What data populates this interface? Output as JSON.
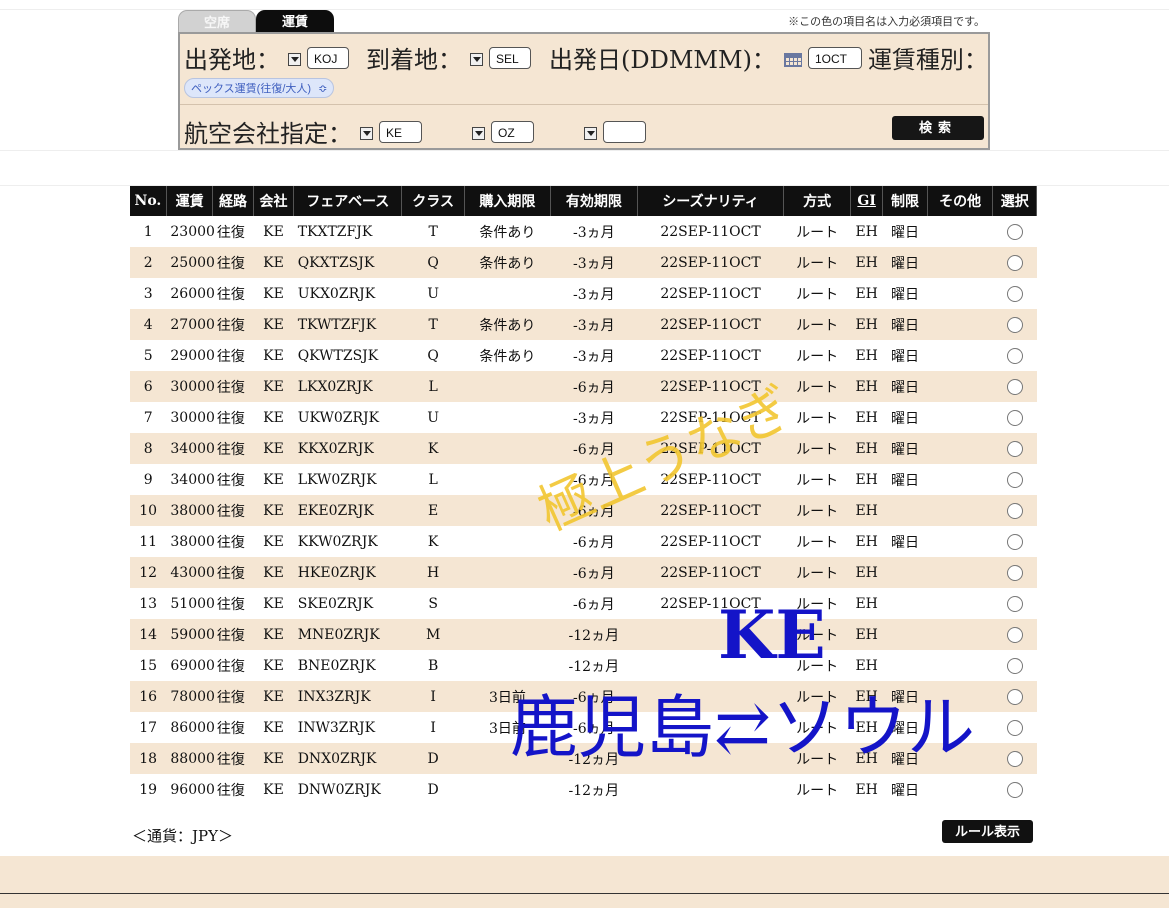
{
  "tabs": [
    {
      "label": "空席",
      "active": false
    },
    {
      "label": "運賃",
      "active": true
    }
  ],
  "required_note": "※この色の項目名は入力必須項目です。",
  "search": {
    "origin_label": "出発地：",
    "origin_value": "KOJ",
    "dest_label": "到着地：",
    "dest_value": "SEL",
    "date_label": "出発日(DDMMM)：",
    "date_value": "1OCT",
    "fare_type_label": "運賃種別：",
    "fare_type_value": "ペックス運賃(往復/大人)",
    "airline_label": "航空会社指定：",
    "airline_values": [
      "KE",
      "OZ",
      ""
    ],
    "search_button": "検索"
  },
  "table": {
    "headers": [
      "No.",
      "運賃",
      "経路",
      "会社",
      "フェアベース",
      "クラス",
      "購入期限",
      "有効期限",
      "シーズナリティ",
      "方式",
      "GI",
      "制限",
      "その他",
      "選択"
    ],
    "rows": [
      [
        "1",
        "23000",
        "往復",
        "KE",
        "TKXTZFJK",
        "T",
        "条件あり",
        "-3ヵ月",
        "22SEP-11OCT",
        "ルート",
        "EH",
        "曜日",
        ""
      ],
      [
        "2",
        "25000",
        "往復",
        "KE",
        "QKXTZSJK",
        "Q",
        "条件あり",
        "-3ヵ月",
        "22SEP-11OCT",
        "ルート",
        "EH",
        "曜日",
        ""
      ],
      [
        "3",
        "26000",
        "往復",
        "KE",
        "UKX0ZRJK",
        "U",
        "",
        "-3ヵ月",
        "22SEP-11OCT",
        "ルート",
        "EH",
        "曜日",
        ""
      ],
      [
        "4",
        "27000",
        "往復",
        "KE",
        "TKWTZFJK",
        "T",
        "条件あり",
        "-3ヵ月",
        "22SEP-11OCT",
        "ルート",
        "EH",
        "曜日",
        ""
      ],
      [
        "5",
        "29000",
        "往復",
        "KE",
        "QKWTZSJK",
        "Q",
        "条件あり",
        "-3ヵ月",
        "22SEP-11OCT",
        "ルート",
        "EH",
        "曜日",
        ""
      ],
      [
        "6",
        "30000",
        "往復",
        "KE",
        "LKX0ZRJK",
        "L",
        "",
        "-6ヵ月",
        "22SEP-11OCT",
        "ルート",
        "EH",
        "曜日",
        ""
      ],
      [
        "7",
        "30000",
        "往復",
        "KE",
        "UKW0ZRJK",
        "U",
        "",
        "-3ヵ月",
        "22SEP-11OCT",
        "ルート",
        "EH",
        "曜日",
        ""
      ],
      [
        "8",
        "34000",
        "往復",
        "KE",
        "KKX0ZRJK",
        "K",
        "",
        "-6ヵ月",
        "22SEP-11OCT",
        "ルート",
        "EH",
        "曜日",
        ""
      ],
      [
        "9",
        "34000",
        "往復",
        "KE",
        "LKW0ZRJK",
        "L",
        "",
        "-6ヵ月",
        "22SEP-11OCT",
        "ルート",
        "EH",
        "曜日",
        ""
      ],
      [
        "10",
        "38000",
        "往復",
        "KE",
        "EKE0ZRJK",
        "E",
        "",
        "-6ヵ月",
        "22SEP-11OCT",
        "ルート",
        "EH",
        "",
        ""
      ],
      [
        "11",
        "38000",
        "往復",
        "KE",
        "KKW0ZRJK",
        "K",
        "",
        "-6ヵ月",
        "22SEP-11OCT",
        "ルート",
        "EH",
        "曜日",
        ""
      ],
      [
        "12",
        "43000",
        "往復",
        "KE",
        "HKE0ZRJK",
        "H",
        "",
        "-6ヵ月",
        "22SEP-11OCT",
        "ルート",
        "EH",
        "",
        ""
      ],
      [
        "13",
        "51000",
        "往復",
        "KE",
        "SKE0ZRJK",
        "S",
        "",
        "-6ヵ月",
        "22SEP-11OCT",
        "ルート",
        "EH",
        "",
        ""
      ],
      [
        "14",
        "59000",
        "往復",
        "KE",
        "MNE0ZRJK",
        "M",
        "",
        "-12ヵ月",
        "",
        "ルート",
        "EH",
        "",
        ""
      ],
      [
        "15",
        "69000",
        "往復",
        "KE",
        "BNE0ZRJK",
        "B",
        "",
        "-12ヵ月",
        "",
        "ルート",
        "EH",
        "",
        ""
      ],
      [
        "16",
        "78000",
        "往復",
        "KE",
        "INX3ZRJK",
        "I",
        "3日前",
        "-6ヵ月",
        "",
        "ルート",
        "EH",
        "曜日",
        ""
      ],
      [
        "17",
        "86000",
        "往復",
        "KE",
        "INW3ZRJK",
        "I",
        "3日前",
        "-6ヵ月",
        "",
        "ルート",
        "EH",
        "曜日",
        ""
      ],
      [
        "18",
        "88000",
        "往復",
        "KE",
        "DNX0ZRJK",
        "D",
        "",
        "-12ヵ月",
        "",
        "ルート",
        "EH",
        "曜日",
        ""
      ],
      [
        "19",
        "96000",
        "往復",
        "KE",
        "DNW0ZRJK",
        "D",
        "",
        "-12ヵ月",
        "",
        "ルート",
        "EH",
        "曜日",
        ""
      ]
    ]
  },
  "currency_note": "＜通貨：JPY＞",
  "rule_button": "ルール表示",
  "overlay": {
    "yellow_text": "極上うなぎ",
    "airline_text": "KE",
    "route_text": "鹿児島⇄ソウル"
  }
}
